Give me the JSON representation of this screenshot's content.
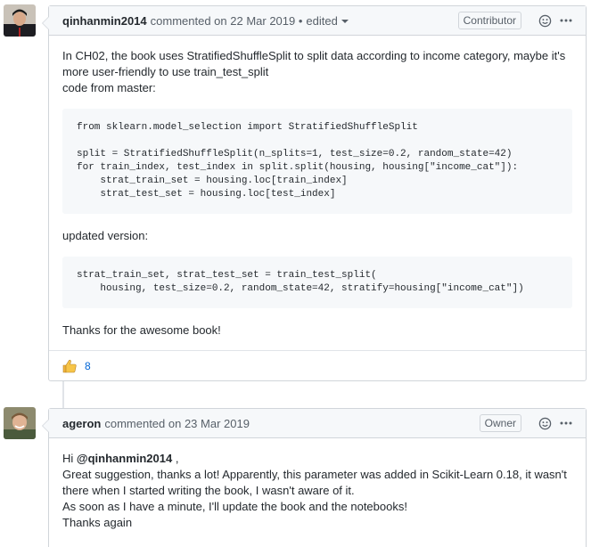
{
  "comments": [
    {
      "author": "qinhanmin2014",
      "meta": "commented on 22 Mar 2019 •",
      "edited": "edited",
      "badge": "Contributor",
      "body": {
        "intro_1": "In CH02, the book uses StratifiedShuffleSplit to split data according to income category, maybe it's",
        "intro_2": "more user-friendly to use train_test_split",
        "intro_3": "code from master:",
        "code_1": "from sklearn.model_selection import StratifiedShuffleSplit\n\nsplit = StratifiedShuffleSplit(n_splits=1, test_size=0.2, random_state=42)\nfor train_index, test_index in split.split(housing, housing[\"income_cat\"]):\n    strat_train_set = housing.loc[train_index]\n    strat_test_set = housing.loc[test_index]",
        "updated_label": "updated version:",
        "code_2": "strat_train_set, strat_test_set = train_test_split(\n    housing, test_size=0.2, random_state=42, stratify=housing[\"income_cat\"])",
        "outro": "Thanks for the awesome book!"
      },
      "reaction": {
        "icon": "thumbs-up-icon",
        "count": "8"
      }
    },
    {
      "author": "ageron",
      "meta": "commented on 23 Mar 2019",
      "badge": "Owner",
      "body": {
        "hi": "Hi",
        "mention": "@qinhanmin2014",
        "hi_end": ",",
        "line_1": "Great suggestion, thanks a lot! Apparently, this parameter was added in Scikit-Learn 0.18, it wasn't",
        "line_2": "there when I started writing the book, I wasn't aware of it.",
        "line_3": "As soon as I have a minute, I'll update the book and the notebooks!",
        "line_4": "Thanks again"
      }
    }
  ],
  "colors": {
    "border": "#d1d5da",
    "header_bg": "#f6f8fa",
    "link": "#0366d6",
    "code_bg": "#f6f8fa"
  }
}
